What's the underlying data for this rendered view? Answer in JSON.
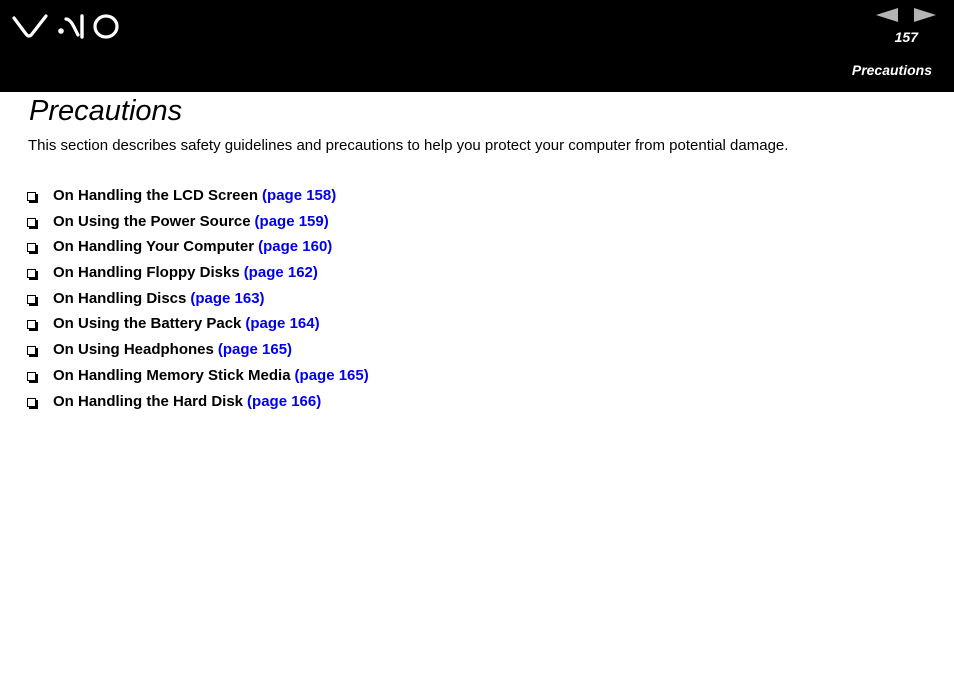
{
  "header": {
    "logo_text": "VAIO",
    "page_number": "157",
    "section_label": "Precautions",
    "nav": {
      "prev_icon": "triangle-left",
      "next_icon": "triangle-right",
      "arrow_color": "#b4b4b4"
    }
  },
  "main": {
    "title": "Precautions",
    "intro": "This section describes safety guidelines and precautions to help you protect your computer from potential damage.",
    "topics": [
      {
        "label": "On Handling the LCD Screen",
        "link": "(page 158)"
      },
      {
        "label": "On Using the Power Source",
        "link": "(page 159)"
      },
      {
        "label": "On Handling Your Computer",
        "link": "(page 160)"
      },
      {
        "label": "On Handling Floppy Disks",
        "link": "(page 162)"
      },
      {
        "label": "On Handling Discs",
        "link": "(page 163)"
      },
      {
        "label": "On Using the Battery Pack",
        "link": "(page 164)"
      },
      {
        "label": "On Using Headphones",
        "link": "(page 165)"
      },
      {
        "label": "On Handling Memory Stick Media",
        "link": "(page 165)"
      },
      {
        "label": "On Handling the Hard Disk",
        "link": "(page 166)"
      }
    ]
  },
  "colors": {
    "header_bg": "#000000",
    "link": "#0000ee",
    "text": "#000000"
  }
}
